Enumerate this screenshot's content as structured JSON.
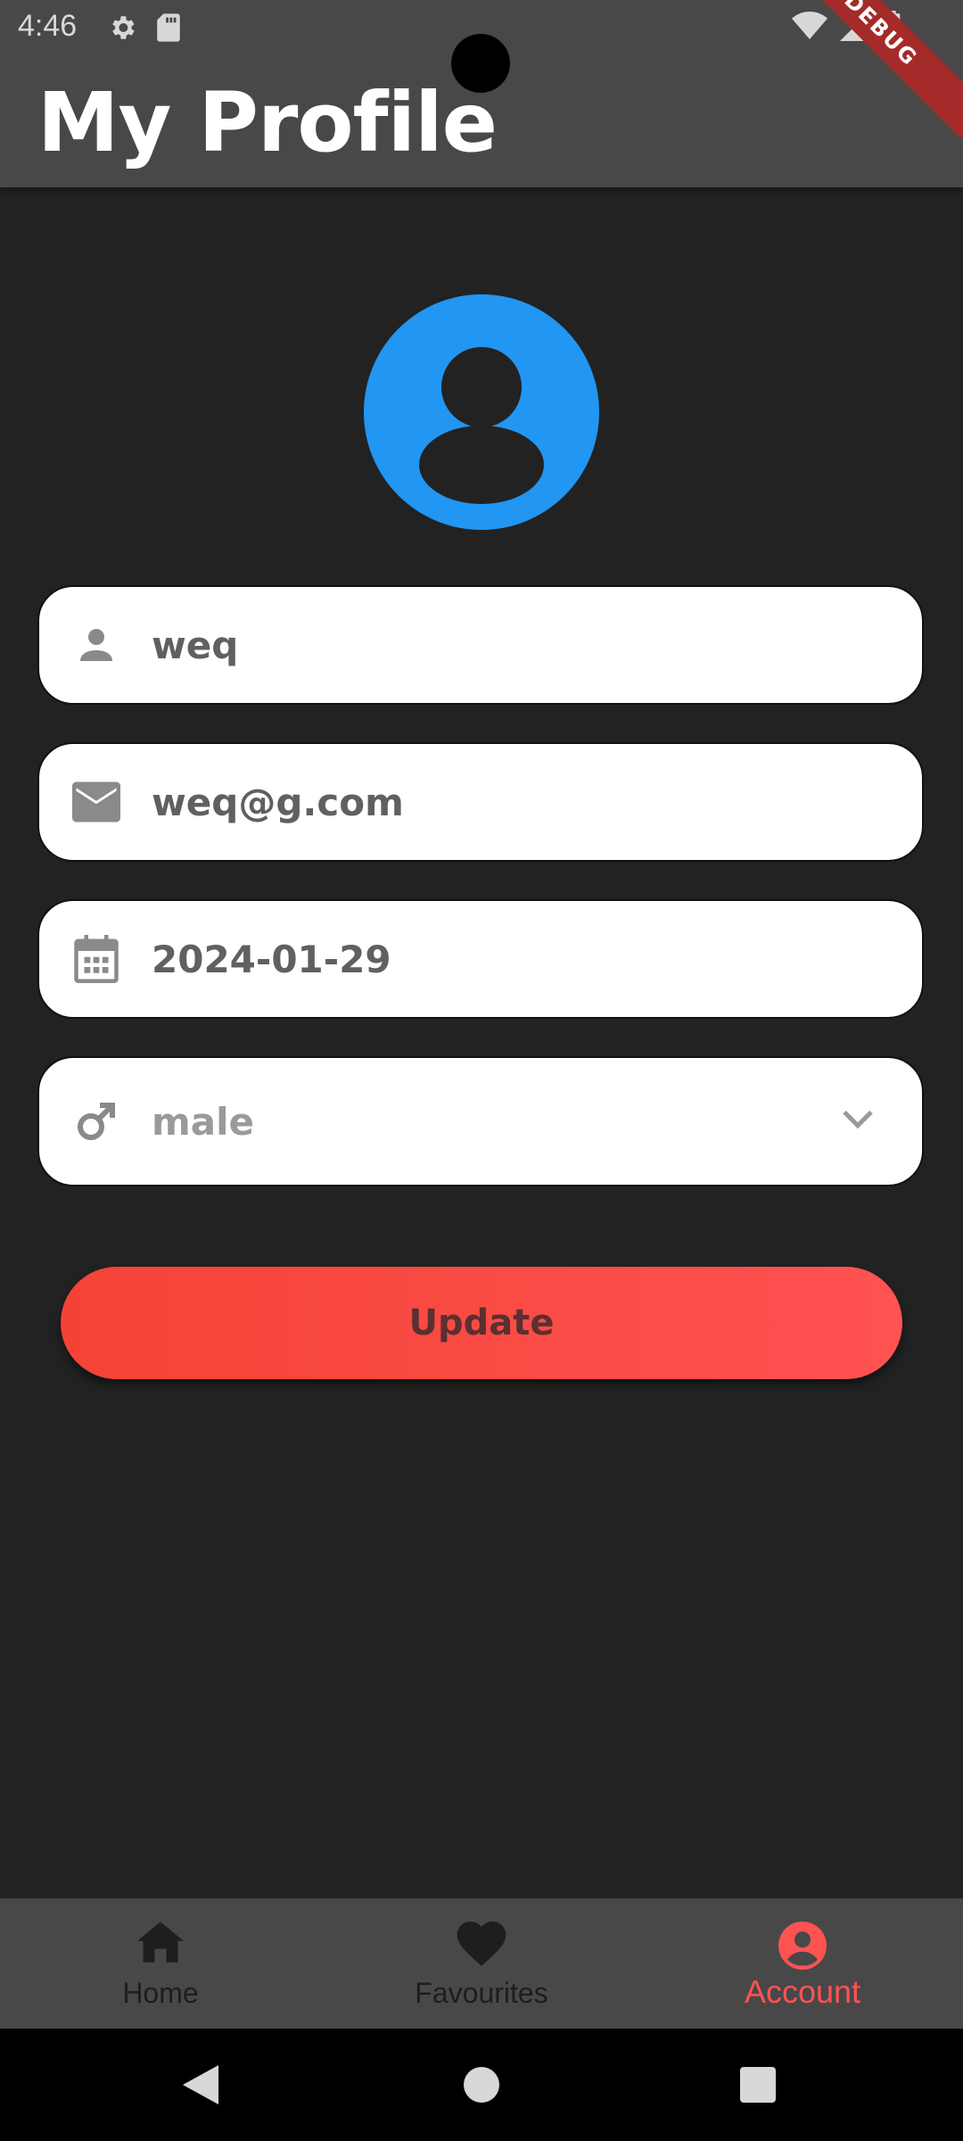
{
  "status_bar": {
    "time": "4:46"
  },
  "debug_banner": "DEBUG",
  "app_bar": {
    "title": "My Profile"
  },
  "form": {
    "name_value": "weq",
    "email_value": "weq@g.com",
    "dob_value": "2024-01-29",
    "gender_selected": "male"
  },
  "update_button_label": "Update",
  "bottom_nav": {
    "items": [
      {
        "label": "Home",
        "icon": "home-icon"
      },
      {
        "label": "Favourites",
        "icon": "heart-icon"
      },
      {
        "label": "Account",
        "icon": "account-circle-icon"
      }
    ],
    "active_index": 2
  },
  "colors": {
    "accent": "#ff5252",
    "avatar_bg": "#2196F3",
    "app_bar": "#484848",
    "background": "#222222"
  }
}
